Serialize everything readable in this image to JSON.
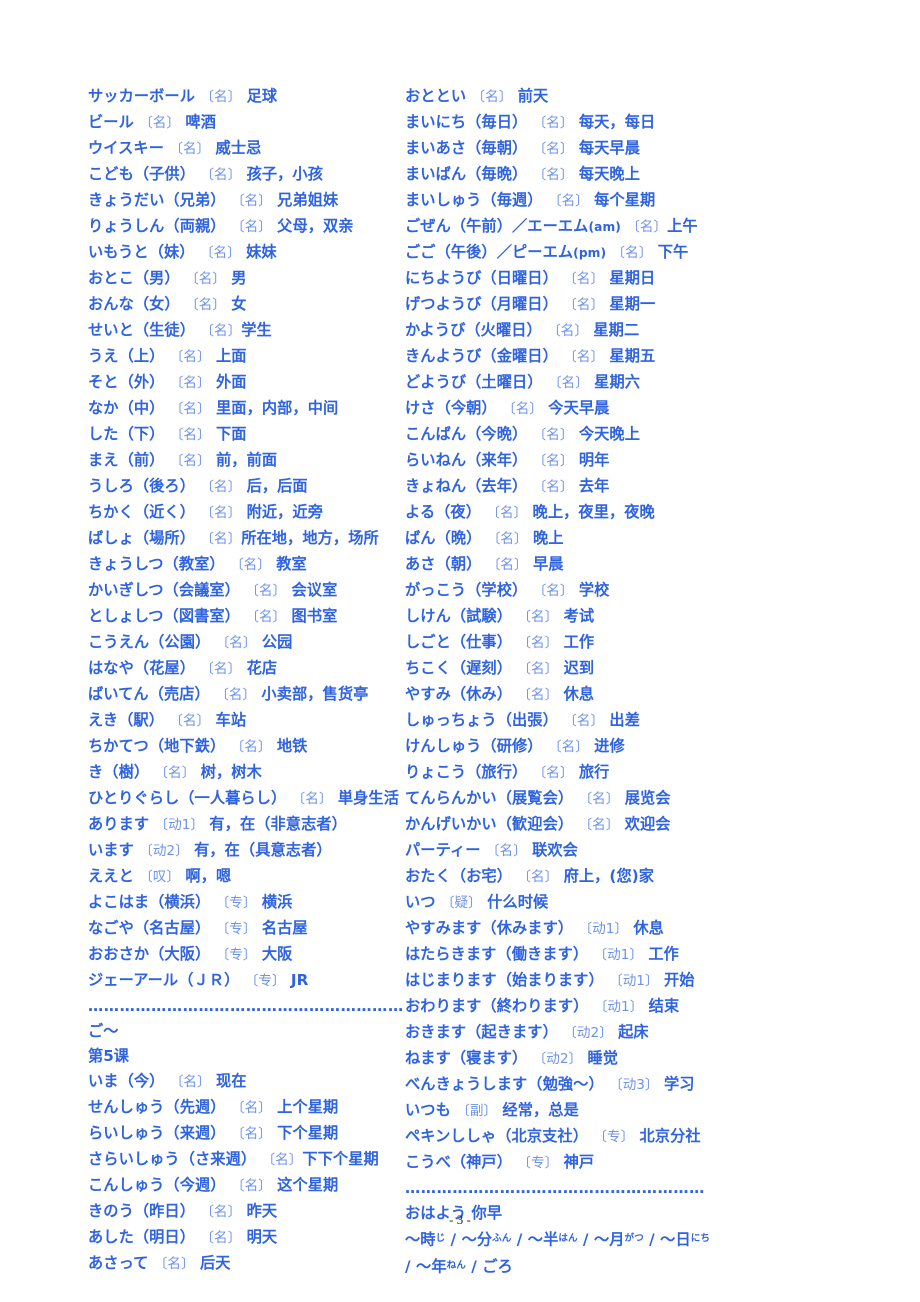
{
  "page": {
    "number_label": "- 3 -",
    "text_color": "#2f63e0",
    "marker_color": "#6f93ea",
    "page_number_color": "#2b2b33"
  },
  "left_column": {
    "entries": [
      "サッカーボール 〔名〕 足球",
      "ビール 〔名〕 啤酒",
      "ウイスキー 〔名〕 威士忌",
      "こども（子供） 〔名〕 孩子，小孩",
      "きょうだい（兄弟） 〔名〕 兄弟姐妹",
      "りょうしん（両親） 〔名〕 父母，双亲",
      "いもうと（妹） 〔名〕 妹妹",
      "おとこ（男） 〔名〕 男",
      "おんな（女） 〔名〕 女",
      "せいと（生徒） 〔名〕学生",
      "うえ（上） 〔名〕 上面",
      "そと（外） 〔名〕 外面",
      "なか（中） 〔名〕 里面，内部，中间",
      "した（下） 〔名〕 下面",
      "まえ（前） 〔名〕 前，前面",
      "うしろ（後ろ） 〔名〕 后，后面",
      "ちかく（近く） 〔名〕 附近，近旁",
      "ばしょ（場所） 〔名〕所在地，地方，场所",
      "きょうしつ（教室） 〔名〕 教室",
      "かいぎしつ（会議室） 〔名〕 会议室",
      "としょしつ（図書室） 〔名〕 图书室",
      "こうえん（公園） 〔名〕 公园",
      "はなや（花屋） 〔名〕 花店",
      "ばいてん（売店） 〔名〕 小卖部，售货亭",
      "えき（駅） 〔名〕 车站",
      "ちかてつ（地下鉄） 〔名〕 地铁",
      "き（樹） 〔名〕 树，树木",
      "ひとりぐらし（一人暮らし） 〔名〕 単身生活",
      "あります 〔动1〕 有，在（非意志者）",
      "います 〔动2〕 有，在（具意志者）",
      "ええと 〔叹〕 啊，嗯",
      "よこはま（横浜） 〔专〕 横浜",
      "なごや（名古屋） 〔专〕 名古屋",
      "おおさか（大阪） 〔专〕 大阪",
      "ジェーアール（ＪＲ） 〔专〕 JR"
    ],
    "separator": "……………………………………………………",
    "suffix_note": "ご〜",
    "lesson_heading": "第5课",
    "lesson_entries": [
      "いま（今） 〔名〕 现在",
      "せんしゅう（先週） 〔名〕 上个星期",
      "らいしゅう（来週） 〔名〕 下个星期",
      "さらいしゅう（さ来週） 〔名〕下下个星期",
      "こんしゅう（今週） 〔名〕 这个星期",
      "きのう（昨日） 〔名〕 昨天",
      "あした（明日） 〔名〕 明天",
      "あさって 〔名〕 后天"
    ]
  },
  "right_column": {
    "entries": [
      "おととい 〔名〕 前天",
      "まいにち（毎日） 〔名〕 每天，每日",
      "まいあさ（毎朝） 〔名〕 每天早晨",
      "まいばん（毎晩） 〔名〕 每天晚上",
      "まいしゅう（毎週） 〔名〕 每个星期",
      "ごぜん（午前）／エーエム(am) 〔名〕上午",
      "ごご（午後）／ピーエム(pm) 〔名〕 下午",
      "にちようび（日曜日） 〔名〕 星期日",
      "げつようび（月曜日） 〔名〕 星期一",
      "かようび（火曜日） 〔名〕 星期二",
      "きんようび（金曜日） 〔名〕 星期五",
      "どようび（土曜日） 〔名〕 星期六",
      "けさ（今朝） 〔名〕 今天早晨",
      "こんばん（今晩） 〔名〕 今天晚上",
      "らいねん（来年） 〔名〕 明年",
      "きょねん（去年） 〔名〕 去年",
      "よる（夜） 〔名〕 晚上，夜里，夜晚",
      "ばん（晩） 〔名〕 晚上",
      "あさ（朝） 〔名〕 早晨",
      "がっこう（学校） 〔名〕 学校",
      "しけん（試験） 〔名〕 考试",
      "しごと（仕事） 〔名〕 工作",
      "ちこく（遅刻） 〔名〕 迟到",
      "やすみ（休み） 〔名〕 休息",
      "しゅっちょう（出張） 〔名〕 出差",
      "けんしゅう（研修） 〔名〕 进修",
      "りょこう（旅行） 〔名〕 旅行",
      "てんらんかい（展覧会） 〔名〕 展览会",
      "かんげいかい（歓迎会） 〔名〕 欢迎会",
      "パーティー 〔名〕 联欢会",
      "おたく（お宅） 〔名〕 府上，(您)家",
      "いつ 〔疑〕 什么时候",
      "やすみます（休みます） 〔动1〕 休息",
      "はたらきます（働きます） 〔动1〕 工作",
      "はじまります（始まります） 〔动1〕 开始",
      "おわります（終わります） 〔动1〕 结束",
      "おきます（起きます） 〔动2〕 起床",
      "ねます（寝ます） 〔动2〕 睡觉",
      "べんきょうします（勉強〜） 〔动3〕 学习",
      "いつも 〔副〕 经常，总是",
      "ペキンししゃ（北京支社） 〔专〕 北京分社",
      "こうべ（神戸） 〔专〕 神戸"
    ],
    "separator": "…………………………………………………",
    "greeting": "おはよう 你早",
    "counters_line1": "〜時じ / 〜分ふん / 〜半はん / 〜月がつ / 〜日にち",
    "counters_line2": "/ 〜年ねん / ごろ",
    "counters_tokens": [
      {
        "base": "〜時",
        "ruby": "じ"
      },
      {
        "base": "〜分",
        "ruby": "ふん"
      },
      {
        "base": "〜半",
        "ruby": "はん"
      },
      {
        "base": "〜月",
        "ruby": "がつ"
      },
      {
        "base": "〜日",
        "ruby": "にち"
      },
      {
        "base": "〜年",
        "ruby": "ねん"
      },
      {
        "base": "ごろ",
        "ruby": ""
      }
    ]
  }
}
